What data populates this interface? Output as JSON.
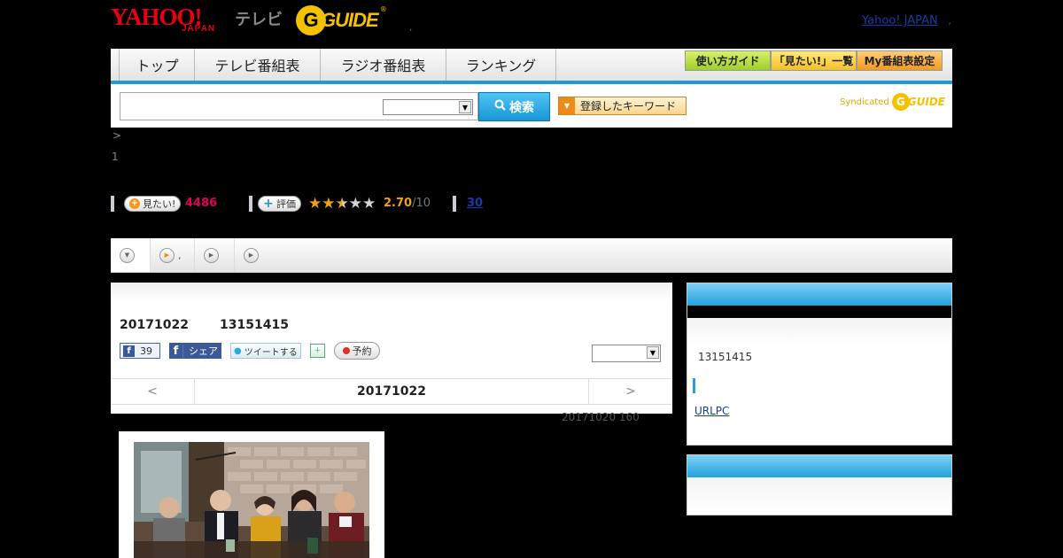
{
  "header": {
    "logo_yahoo": "YAHOO!",
    "logo_japan": "JAPAN",
    "logo_tv": "テレビ",
    "logo_gguide_g": "G",
    "logo_gguide_text": "GUIDE",
    "logo_gguide_reg": "®",
    "header_dot": ",",
    "yahoo_japan_link": "Yahoo! JAPAN",
    "yj_dot": ","
  },
  "nav": {
    "tabs": [
      "トップ",
      "テレビ番組表",
      "ラジオ番組表",
      "ランキング"
    ],
    "guide_btn": "使い方ガイド",
    "mitai_list_btn": "「見たい!」一覧",
    "my_schedule_btn": "My番組表設定"
  },
  "search": {
    "input_value": "",
    "select_value": "",
    "button_label": "検索",
    "keyword_btn": "登録したキーワード",
    "syndicated": "Syndicated",
    "syn_g": "G",
    "syn_guide": "GUIDE"
  },
  "breadcrumb": ">",
  "page_number": "1",
  "stats": {
    "mitai_label": "見たい!",
    "mitai_count": "4486",
    "rating_label": "評価",
    "rating_value": "2.70",
    "rating_max": "/10",
    "rating_stars_filled": 2.5,
    "rating_stars_total": 5,
    "review_count": "30"
  },
  "tabrow": {
    "item2_suffix": ","
  },
  "program": {
    "date": "20171022",
    "time": "13151415",
    "fb_like_count": "39",
    "fb_share": "シェア",
    "tweet": "ツイートする",
    "reserve": "予約",
    "episode_select_value": "",
    "prev_arrow": "<",
    "nav_date": "20171022",
    "next_arrow": ">",
    "update_note": "20171020  160"
  },
  "side": {
    "time": "13151415",
    "link": "URLPC"
  },
  "colors": {
    "accent_blue": "#1e9bd7",
    "mitai_pink": "#e0005a",
    "star_orange": "#f2a20c",
    "gguide_yellow": "#f2c200",
    "yahoo_red": "#e60012"
  }
}
